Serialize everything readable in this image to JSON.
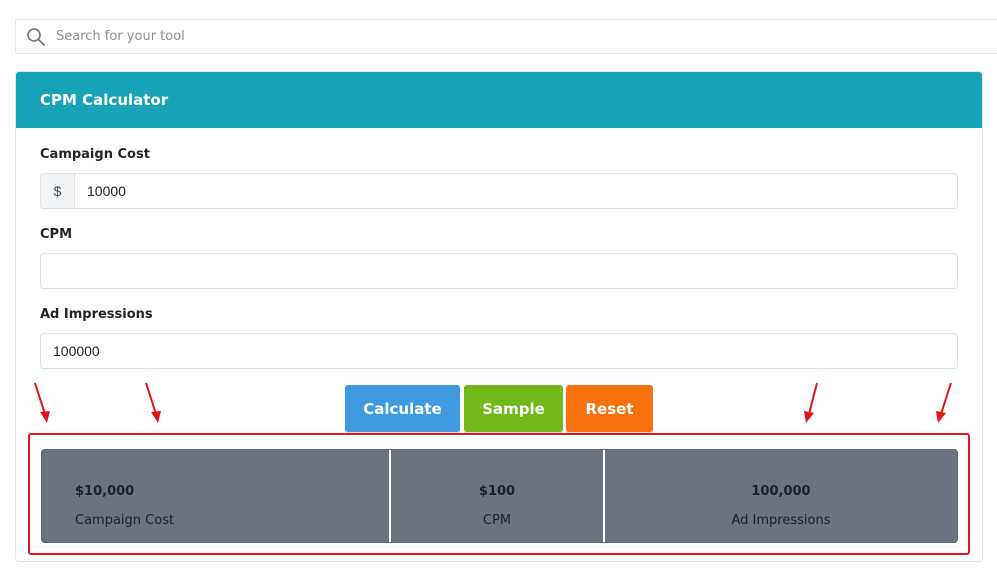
{
  "search": {
    "placeholder": "Search for your tool",
    "icon": "search-icon"
  },
  "calculator": {
    "title": "CPM Calculator",
    "fields": {
      "campaign_cost": {
        "label": "Campaign Cost",
        "prefix": "$",
        "value": "10000"
      },
      "cpm": {
        "label": "CPM",
        "value": ""
      },
      "ad_impressions": {
        "label": "Ad Impressions",
        "value": "100000"
      }
    },
    "buttons": {
      "calculate": "Calculate",
      "sample": "Sample",
      "reset": "Reset"
    },
    "results": [
      {
        "value": "$10,000",
        "caption": "Campaign Cost"
      },
      {
        "value": "$100",
        "caption": "CPM"
      },
      {
        "value": "100,000",
        "caption": "Ad Impressions"
      }
    ]
  },
  "colors": {
    "header": "#17a2b8",
    "calculate": "#3f9ae0",
    "sample": "#72b81a",
    "reset": "#f7710f",
    "results_bg": "#6c727e",
    "annotation": "#e3141b"
  }
}
